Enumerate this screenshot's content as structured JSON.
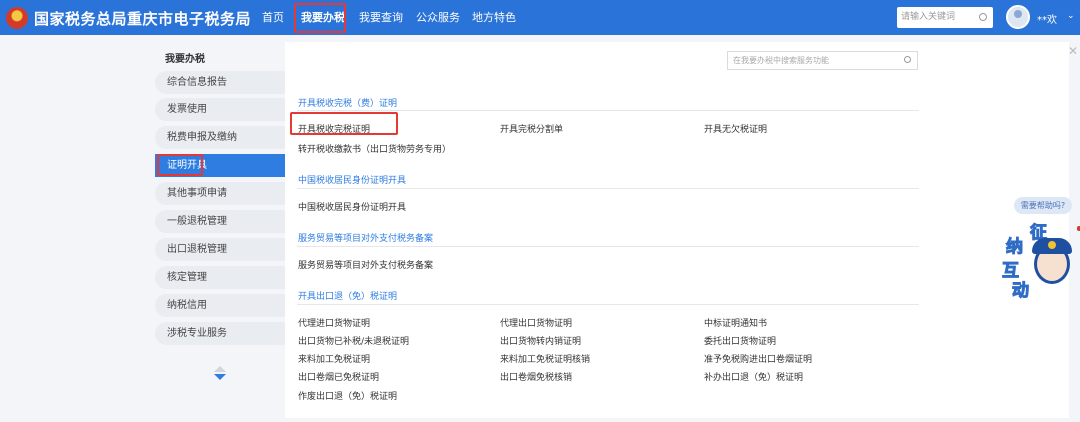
{
  "header": {
    "title": "国家税务总局重庆市电子税务局",
    "nav": [
      "首页",
      "我要办税",
      "我要查询",
      "公众服务",
      "地方特色"
    ],
    "active_nav": "我要办税",
    "search_placeholder": "请输入关键词",
    "username": "**欢",
    "colors": {
      "bar": "#2a73d8",
      "highlight": "#e53935"
    }
  },
  "sidebar": {
    "title": "我要办税",
    "items": [
      "综合信息报告",
      "发票使用",
      "税费申报及缴纳",
      "证明开具",
      "其他事项申请",
      "一般退税管理",
      "出口退税管理",
      "核定管理",
      "纳税信用",
      "涉税专业服务"
    ],
    "active_item": "证明开具"
  },
  "content": {
    "search_placeholder": "在我要办税中搜索服务功能",
    "sections": [
      {
        "title": "开具税收完税（费）证明",
        "links": [
          "开具税收完税证明",
          "开具完税分割单",
          "开具无欠税证明",
          "转开税收缴款书（出口货物劳务专用）"
        ]
      },
      {
        "title": "中国税收居民身份证明开具",
        "links": [
          "中国税收居民身份证明开具"
        ]
      },
      {
        "title": "服务贸易等项目对外支付税务备案",
        "links": [
          "服务贸易等项目对外支付税务备案"
        ]
      },
      {
        "title": "开具出口退（免）税证明",
        "links": [
          "代理进口货物证明",
          "代理出口货物证明",
          "中标证明通知书",
          "出口货物已补税/未退税证明",
          "出口货物转内销证明",
          "委托出口货物证明",
          "来料加工免税证明",
          "来料加工免税证明核销",
          "准予免税购进出口卷烟证明",
          "出口卷烟已免税证明",
          "出口卷烟免税核销",
          "补办出口退（免）税证明",
          "作废出口退（免）税证明"
        ]
      }
    ]
  },
  "widget": {
    "help_text": "需要帮助吗?",
    "mascot_chars": [
      "征",
      "纳",
      "互",
      "动"
    ]
  }
}
